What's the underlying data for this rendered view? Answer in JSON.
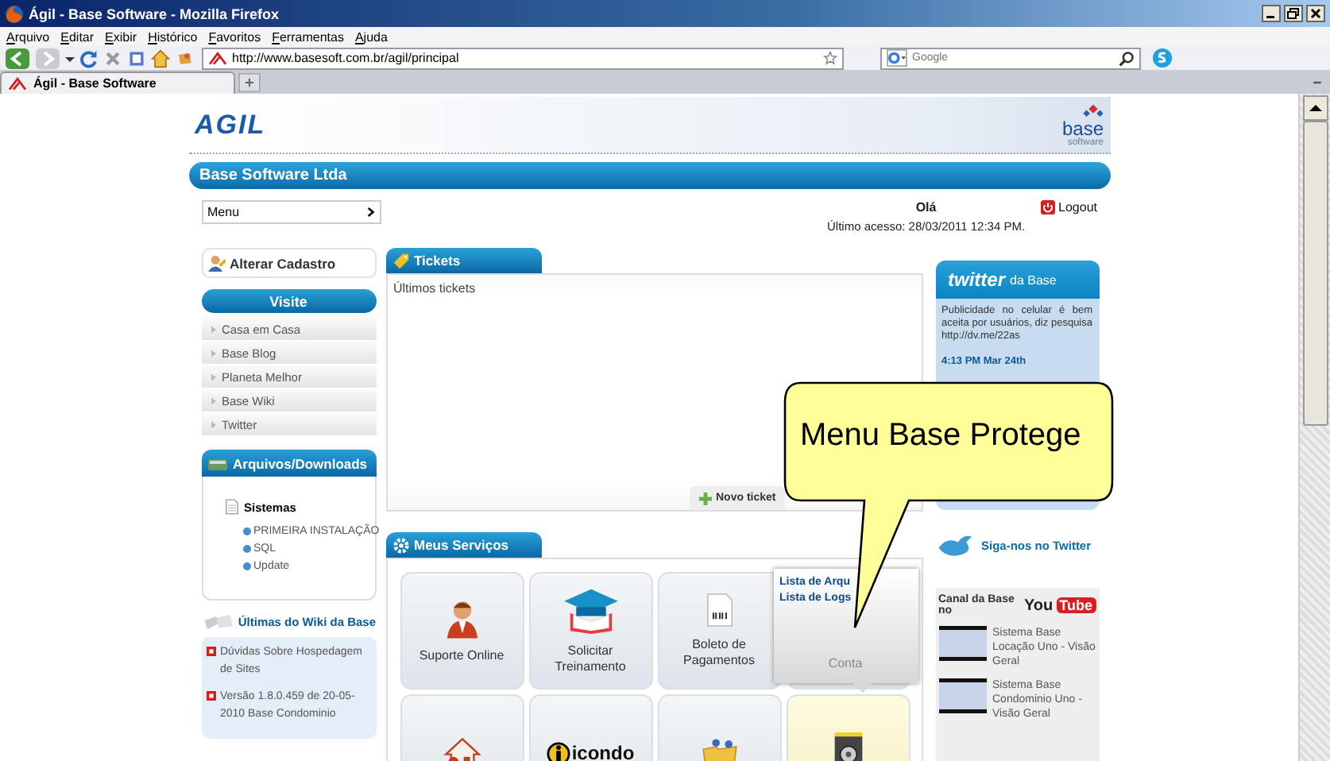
{
  "window": {
    "title": "Ágil - Base Software - Mozilla Firefox"
  },
  "menu_bar": [
    "Arquivo",
    "Editar",
    "Exibir",
    "Histórico",
    "Favoritos",
    "Ferramentas",
    "Ajuda"
  ],
  "address_bar": {
    "value": "http://www.basesoft.com.br/agil/principal"
  },
  "search": {
    "placeholder": "Google"
  },
  "tabs": [
    {
      "label": "Ágil - Base Software",
      "selected": true
    }
  ],
  "page": {
    "logo": "AGIL",
    "brand": "base",
    "brand_sub": "software",
    "company": "Base Software Ltda",
    "menu_select": "Menu",
    "greeting": "Olá",
    "last_access": "Último acesso: 28/03/2011  12:34 PM.",
    "logout": "Logout",
    "profile_link": "Alterar Cadastro",
    "visit": {
      "title": "Visite",
      "links": [
        "Casa em Casa",
        "Base Blog",
        "Planeta Melhor",
        "Base Wiki",
        "Twitter"
      ]
    },
    "downloads": {
      "title": "Arquivos/Downloads",
      "folder": "Sistemas",
      "items": [
        "PRIMEIRA INSTALAÇÃO",
        "SQL",
        "Update"
      ]
    },
    "wiki": {
      "title": "Últimas do Wiki da Base",
      "items": [
        "Dúvidas Sobre Hospedagem de Sites",
        "Versão 1.8.0.459 de 20-05-2010 Base Condominio"
      ]
    },
    "tickets": {
      "title": "Tickets",
      "subtitle": "Últimos tickets",
      "new_button": "Novo ticket"
    },
    "services": {
      "title": "Meus Serviços",
      "popup_links": [
        "Lista de Arqu",
        "Lista de Logs"
      ],
      "tiles": [
        {
          "kind": "support",
          "label": "Suporte Online",
          "popup_open": false,
          "highlighted": false
        },
        {
          "kind": "training",
          "label": "Solicitar Treinamento",
          "popup_open": false,
          "highlighted": false
        },
        {
          "kind": "invoice",
          "label": "Boleto de Pagamentos",
          "popup_open": false,
          "highlighted": false
        },
        {
          "kind": "account",
          "label": "Conta",
          "popup_open": true,
          "highlighted": false
        },
        {
          "kind": "home",
          "popup_open": false,
          "highlighted": false
        },
        {
          "kind": "icondo",
          "logo_text": "icondo",
          "popup_open": false,
          "highlighted": false
        },
        {
          "kind": "folder",
          "popup_open": false,
          "highlighted": false
        },
        {
          "kind": "safe",
          "popup_open": false,
          "highlighted": true
        }
      ]
    },
    "twitter": {
      "logo": "twitter",
      "suffix": "da Base",
      "tweet": "Publicidade no celular é bem aceita por usuários, diz pesquisa http://dv.me/22as",
      "time": "4:13 PM Mar 24th",
      "follow": "Siga-nos no Twitter"
    },
    "youtube": {
      "title": "Canal da Base no",
      "logo_you": "You",
      "logo_tube": "Tube",
      "videos": [
        "Sistema Base Locação Uno - Visão Geral",
        "Sistema Base Condominio Uno - Visão Geral"
      ]
    }
  },
  "callout": {
    "text": "Menu Base Protege"
  }
}
